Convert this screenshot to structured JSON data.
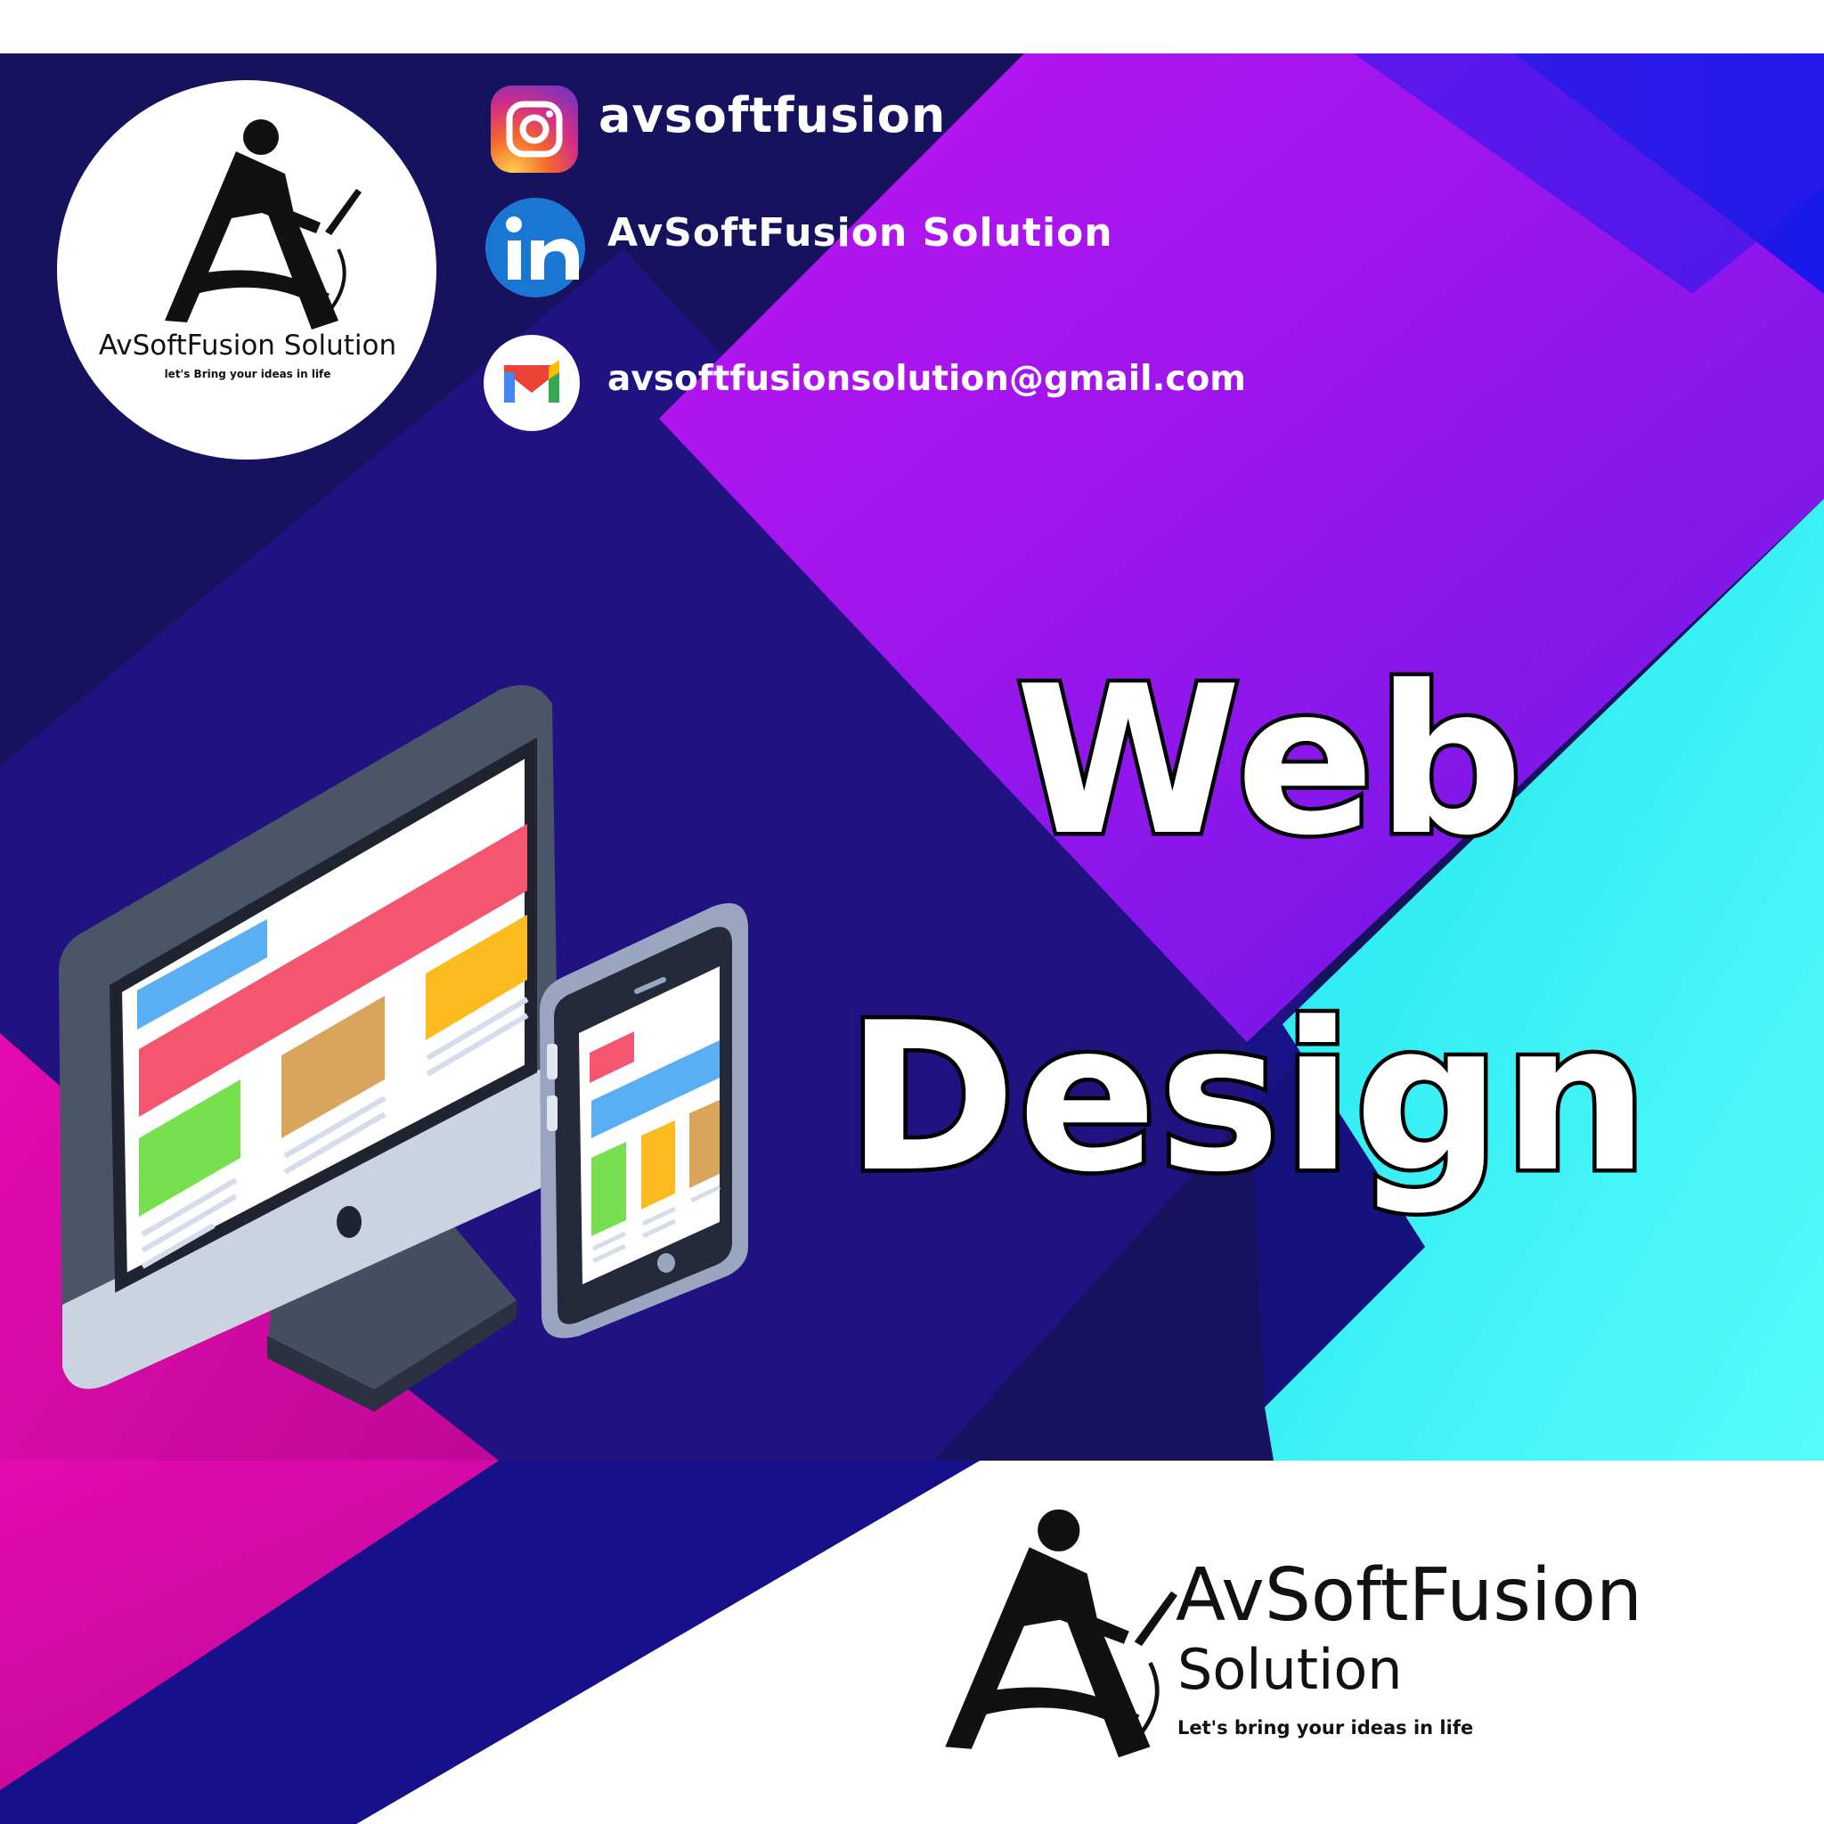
{
  "social": {
    "instagram": {
      "icon": "instagram-icon",
      "handle": "avsoftfusion"
    },
    "linkedin": {
      "icon": "linkedin-icon",
      "name": "AvSoftFusion Solution"
    },
    "email": {
      "icon": "gmail-icon",
      "address": "avsoftfusionsolution@gmail.com"
    }
  },
  "headline": {
    "line1": "Web",
    "line2": "Design"
  },
  "logo_top": {
    "name": "AvSoftFusion Solution",
    "tagline": "let's Bring your ideas in life"
  },
  "logo_bottom": {
    "name": "AvSoftFusion",
    "sub": "Solution",
    "tagline": "Let's bring your ideas in life"
  },
  "colors": {
    "navy": "#17125e",
    "purple": "#8a16ee",
    "magenta": "#de0aa8",
    "cyan": "#2ff3f3",
    "blue": "#1f20e6"
  },
  "illustration": {
    "name": "monitor-and-phone-web-layout"
  }
}
